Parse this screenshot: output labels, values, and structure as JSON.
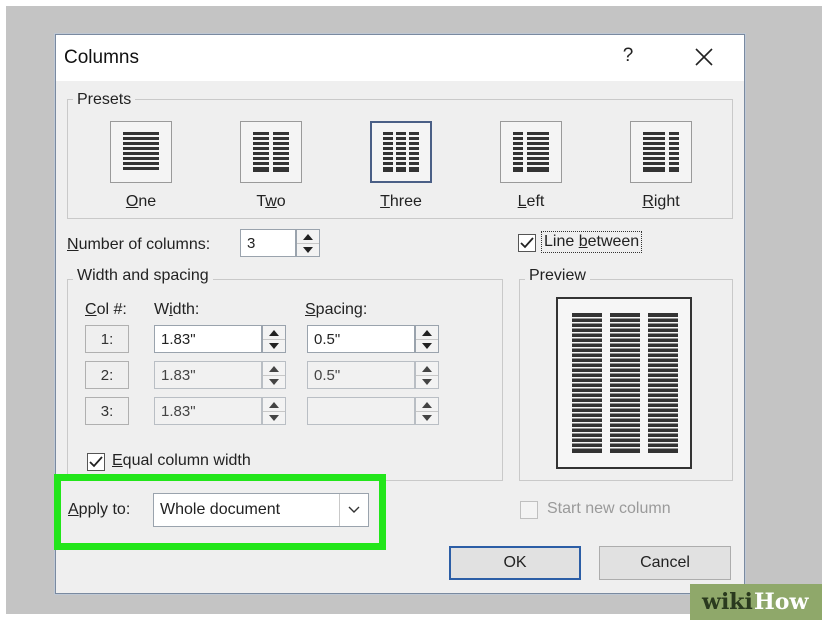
{
  "dialog": {
    "title": "Columns",
    "help_label": "?",
    "presets": {
      "group_label": "Presets",
      "items": [
        {
          "label": "One",
          "mnemonic": "O",
          "rest": "ne",
          "icon": "one-column-preset-icon"
        },
        {
          "label": "Two",
          "mnemonic": "w",
          "prefix": "T",
          "rest": "o",
          "icon": "two-column-preset-icon"
        },
        {
          "label": "Three",
          "mnemonic": "T",
          "rest": "hree",
          "icon": "three-column-preset-icon",
          "selected": true
        },
        {
          "label": "Left",
          "mnemonic": "L",
          "rest": "eft",
          "icon": "left-column-preset-icon"
        },
        {
          "label": "Right",
          "mnemonic": "R",
          "rest": "ight",
          "icon": "right-column-preset-icon"
        }
      ]
    },
    "number_of_columns": {
      "label_mnemonic": "N",
      "label_rest": "umber of columns:",
      "value": "3"
    },
    "line_between": {
      "label_pre": "Line ",
      "label_mnemonic": "b",
      "label_rest": "etween",
      "checked": true
    },
    "width_spacing": {
      "group_label": "Width and spacing",
      "col_header_mnemonic": "C",
      "col_header_rest": "ol #:",
      "width_header_pre": "W",
      "width_header_mnemonic": "i",
      "width_header_rest": "dth:",
      "spacing_header_mnemonic": "S",
      "spacing_header_rest": "pacing:",
      "rows": [
        {
          "col": "1:",
          "width": "1.83\"",
          "spacing": "0.5\""
        },
        {
          "col": "2:",
          "width": "1.83\"",
          "spacing": "0.5\""
        },
        {
          "col": "3:",
          "width": "1.83\"",
          "spacing": ""
        }
      ]
    },
    "equal_width": {
      "label_mnemonic": "E",
      "label_rest": "qual column width",
      "checked": true
    },
    "preview": {
      "group_label": "Preview"
    },
    "apply_to": {
      "label_mnemonic": "A",
      "label_rest": "pply to:",
      "value": "Whole document"
    },
    "start_new_column": {
      "label": "Start new column",
      "checked": false
    },
    "buttons": {
      "ok": "OK",
      "cancel": "Cancel"
    }
  },
  "watermark": {
    "wiki": "wiki",
    "how": "How"
  },
  "colors": {
    "highlight": "#22e61a",
    "default_button_border": "#2c5ea6",
    "selected_preset_border": "#4a5f86"
  }
}
